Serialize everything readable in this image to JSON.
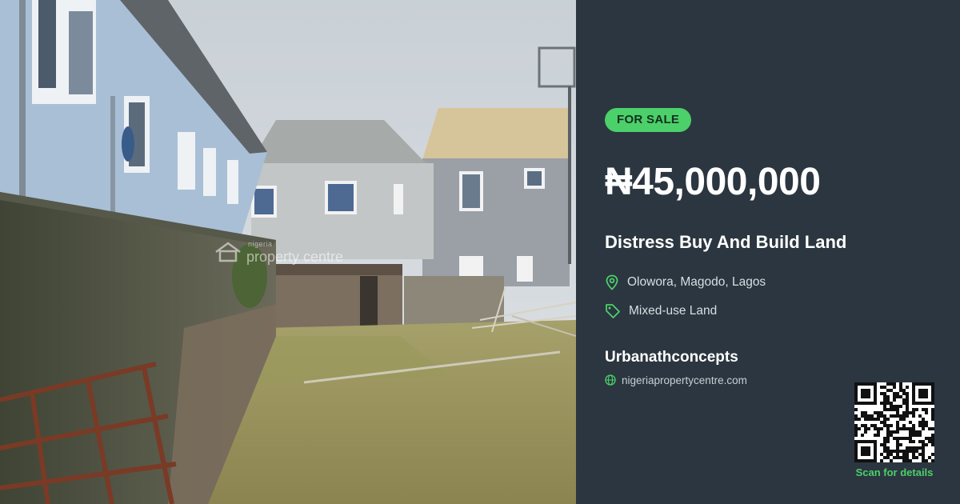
{
  "photo": {
    "watermark_small": "nigeria",
    "watermark_main": "property centre"
  },
  "listing": {
    "badge": "FOR SALE",
    "price": "₦45,000,000",
    "title": "Distress Buy And Build Land",
    "location": "Olowora, Magodo, Lagos",
    "property_type": "Mixed-use Land"
  },
  "agent": {
    "name": "Urbanathconcepts",
    "website": "nigeriapropertycentre.com"
  },
  "qr": {
    "caption": "Scan for details"
  },
  "colors": {
    "panel_background": "#2b3640",
    "accent_green": "#4cd06a",
    "text_white": "#ffffff"
  },
  "icons": {
    "location": "map-pin-icon",
    "type": "tag-icon",
    "website": "globe-icon",
    "watermark": "house-logo-icon"
  }
}
